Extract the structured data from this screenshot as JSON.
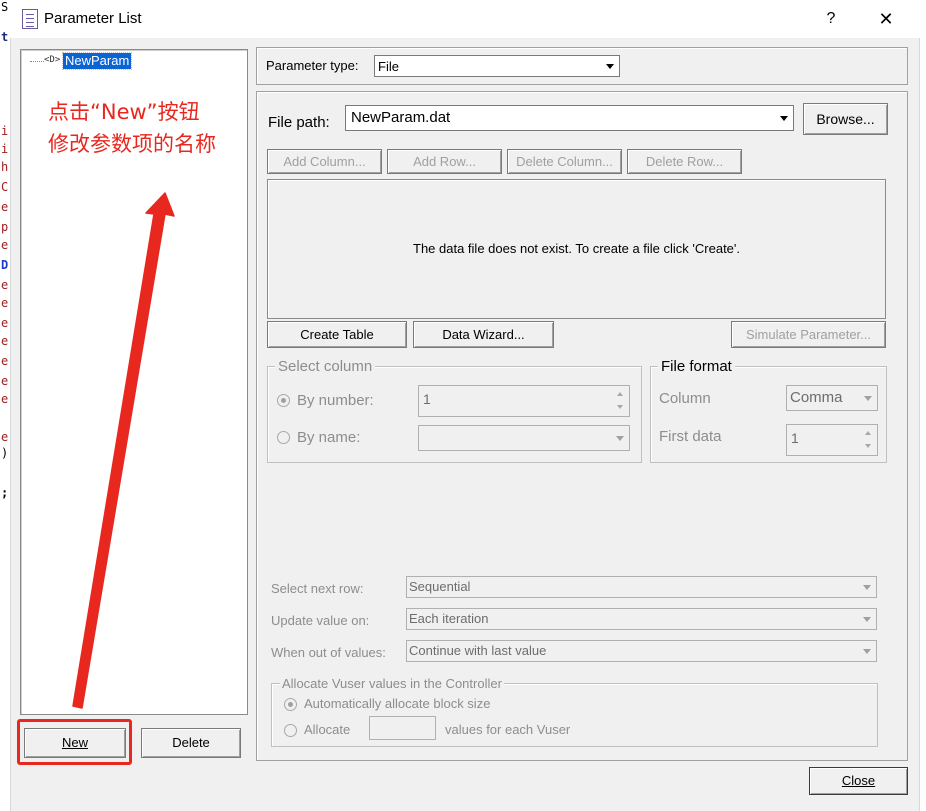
{
  "window": {
    "title": "Parameter List",
    "help_glyph": "?",
    "close_glyph": "✕"
  },
  "tree": {
    "node_icon": "<D>",
    "selected_label": "NewParam"
  },
  "left_buttons": {
    "new_label": "New",
    "delete_label": "Delete"
  },
  "parameter_type": {
    "label": "Parameter type:",
    "value": "File"
  },
  "file_path": {
    "label": "File path:",
    "value": "NewParam.dat",
    "browse_label": "Browse..."
  },
  "table_buttons": {
    "add_column": "Add Column...",
    "add_row": "Add Row...",
    "delete_column": "Delete Column...",
    "delete_row": "Delete Row..."
  },
  "data_area": {
    "message": "The data file does not exist. To create a file click 'Create'."
  },
  "action_buttons": {
    "create_table": "Create Table",
    "data_wizard": "Data Wizard...",
    "simulate_parameter": "Simulate Parameter..."
  },
  "select_column": {
    "legend": "Select column",
    "by_number_label": "By number:",
    "by_number_value": "1",
    "by_name_label": "By name:",
    "by_name_value": ""
  },
  "file_format": {
    "legend": "File format",
    "column_label": "Column",
    "column_value": "Comma",
    "first_data_label": "First data",
    "first_data_value": "1"
  },
  "options": {
    "select_next_row_label": "Select next row:",
    "select_next_row_value": "Sequential",
    "update_value_on_label": "Update value on:",
    "update_value_on_value": "Each iteration",
    "when_out_label": "When out of values:",
    "when_out_value": "Continue with last value"
  },
  "allocate": {
    "legend": "Allocate Vuser values in the Controller",
    "auto_label": "Automatically allocate block size",
    "allocate_label": "Allocate",
    "allocate_value": "",
    "suffix": "values for each Vuser"
  },
  "close_button": "Close",
  "annotation": {
    "line1": "点击“New”按钮",
    "line2": "修改参数项的名称",
    "color": "#e8281e"
  },
  "background_editor": {
    "chars": [
      "S",
      "t",
      "i",
      "i",
      "h",
      "C",
      "e",
      "p",
      "e",
      "D",
      "e",
      "e",
      "e",
      "e",
      "e",
      "e",
      "e",
      "e",
      ")",
      ";"
    ]
  }
}
